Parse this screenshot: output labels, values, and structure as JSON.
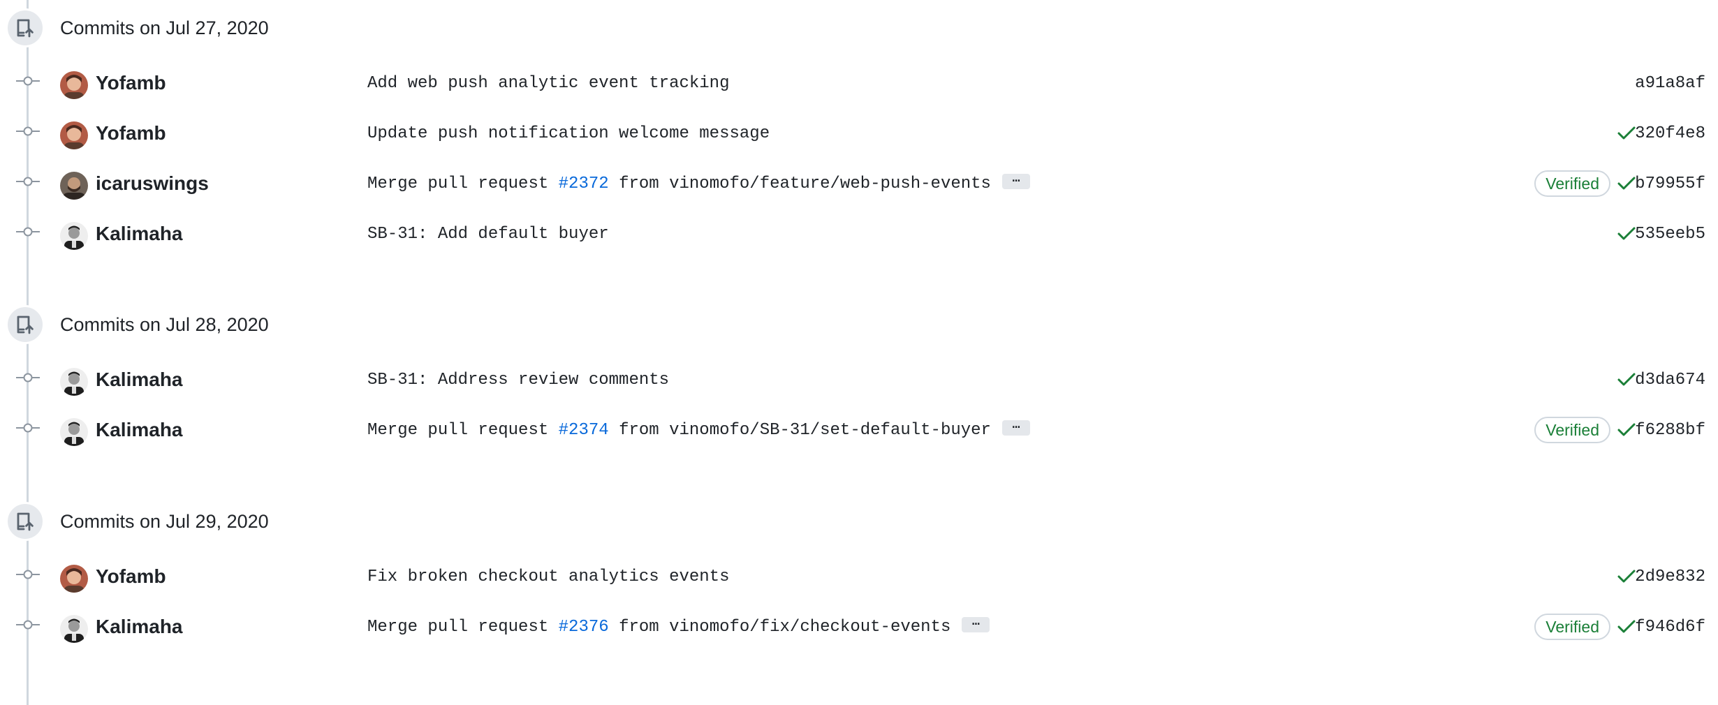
{
  "groups": [
    {
      "title": "Commits on Jul 27, 2020",
      "commits": [
        {
          "author": "Yofamb",
          "message_prefix": "Add web push analytic event tracking",
          "pr": "",
          "message_suffix": "",
          "verified": "",
          "sha": "a91a8af",
          "status": "none",
          "avatar": "yofamb"
        },
        {
          "author": "Yofamb",
          "message_prefix": "Update push notification welcome message",
          "pr": "",
          "message_suffix": "",
          "verified": "",
          "sha": "320f4e8",
          "status": "success",
          "avatar": "yofamb"
        },
        {
          "author": "icaruswings",
          "message_prefix": "Merge pull request ",
          "pr": "#2372",
          "message_suffix": " from vinomofo/feature/web-push-events",
          "verified": "Verified",
          "sha": "b79955f",
          "status": "success",
          "avatar": "icaruswings"
        },
        {
          "author": "Kalimaha",
          "message_prefix": "SB-31: Add default buyer",
          "pr": "",
          "message_suffix": "",
          "verified": "",
          "sha": "535eeb5",
          "status": "success",
          "avatar": "kalimaha"
        }
      ]
    },
    {
      "title": "Commits on Jul 28, 2020",
      "commits": [
        {
          "author": "Kalimaha",
          "message_prefix": "SB-31: Address review comments",
          "pr": "",
          "message_suffix": "",
          "verified": "",
          "sha": "d3da674",
          "status": "success",
          "avatar": "kalimaha"
        },
        {
          "author": "Kalimaha",
          "message_prefix": "Merge pull request ",
          "pr": "#2374",
          "message_suffix": " from vinomofo/SB-31/set-default-buyer",
          "verified": "Verified",
          "sha": "f6288bf",
          "status": "success",
          "avatar": "kalimaha"
        }
      ]
    },
    {
      "title": "Commits on Jul 29, 2020",
      "commits": [
        {
          "author": "Yofamb",
          "message_prefix": "Fix broken checkout analytics events",
          "pr": "",
          "message_suffix": "",
          "verified": "",
          "sha": "2d9e832",
          "status": "success",
          "avatar": "yofamb"
        },
        {
          "author": "Kalimaha",
          "message_prefix": "Merge pull request ",
          "pr": "#2376",
          "message_suffix": " from vinomofo/fix/checkout-events",
          "verified": "Verified",
          "sha": "f946d6f",
          "status": "success",
          "avatar": "kalimaha"
        }
      ]
    }
  ],
  "icons": {
    "group_header": "repo-push-icon",
    "commit_node": "git-commit-icon",
    "status": "check-icon",
    "expand": "ellipsis-icon"
  },
  "colors": {
    "link": "#0969da",
    "success": "#1a7f37",
    "timeline": "#d0d7de"
  }
}
